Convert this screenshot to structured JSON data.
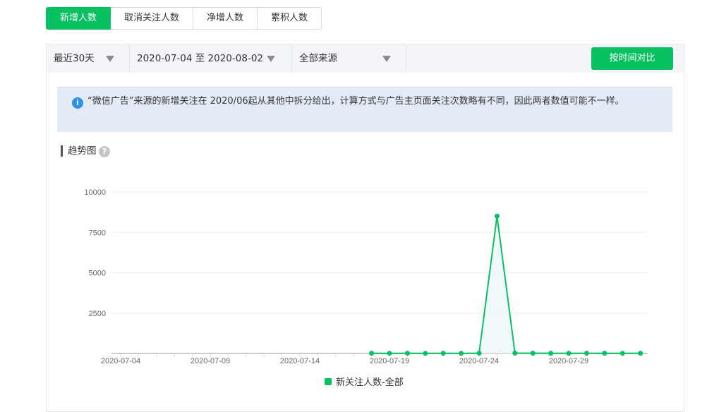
{
  "tabs": [
    {
      "label": "新增人数",
      "active": true
    },
    {
      "label": "取消关注人数",
      "active": false
    },
    {
      "label": "净增人数",
      "active": false
    },
    {
      "label": "累积人数",
      "active": false
    }
  ],
  "filters": {
    "range": "最近30天",
    "dates": "2020-07-04 至 2020-08-02",
    "source": "全部来源",
    "compare_label": "按时间对比"
  },
  "notice": {
    "icon": "info-icon",
    "text": "“微信广告”来源的新增关注在 2020/06起从其他中拆分给出，计算方式与广告主页面关注次数略有不同，因此两者数值可能不一样。"
  },
  "section": {
    "title": "趋势图",
    "help_icon": "help-icon"
  },
  "colors": {
    "accent": "#07c160",
    "notice_bg": "#e3ebf6",
    "info": "#2a93e9"
  },
  "chart_data": {
    "type": "line",
    "x_ticks": [
      "2020-07-04",
      "2020-07-09",
      "2020-07-14",
      "2020-07-19",
      "2020-07-24",
      "2020-07-29"
    ],
    "y_ticks": [
      2500,
      5000,
      7500,
      10000
    ],
    "ylim": [
      0,
      10000
    ],
    "x": [
      "2020-07-18",
      "2020-07-19",
      "2020-07-20",
      "2020-07-21",
      "2020-07-22",
      "2020-07-23",
      "2020-07-24",
      "2020-07-25",
      "2020-07-26",
      "2020-07-27",
      "2020-07-28",
      "2020-07-29",
      "2020-07-30",
      "2020-07-31",
      "2020-08-01",
      "2020-08-02"
    ],
    "series": [
      {
        "name": "新关注人数-全部",
        "color": "#07c160",
        "values": [
          10,
          8,
          12,
          6,
          9,
          7,
          14,
          8500,
          20,
          15,
          11,
          9,
          13,
          10,
          8,
          12
        ]
      }
    ],
    "grid": true,
    "legend": "bottom"
  }
}
